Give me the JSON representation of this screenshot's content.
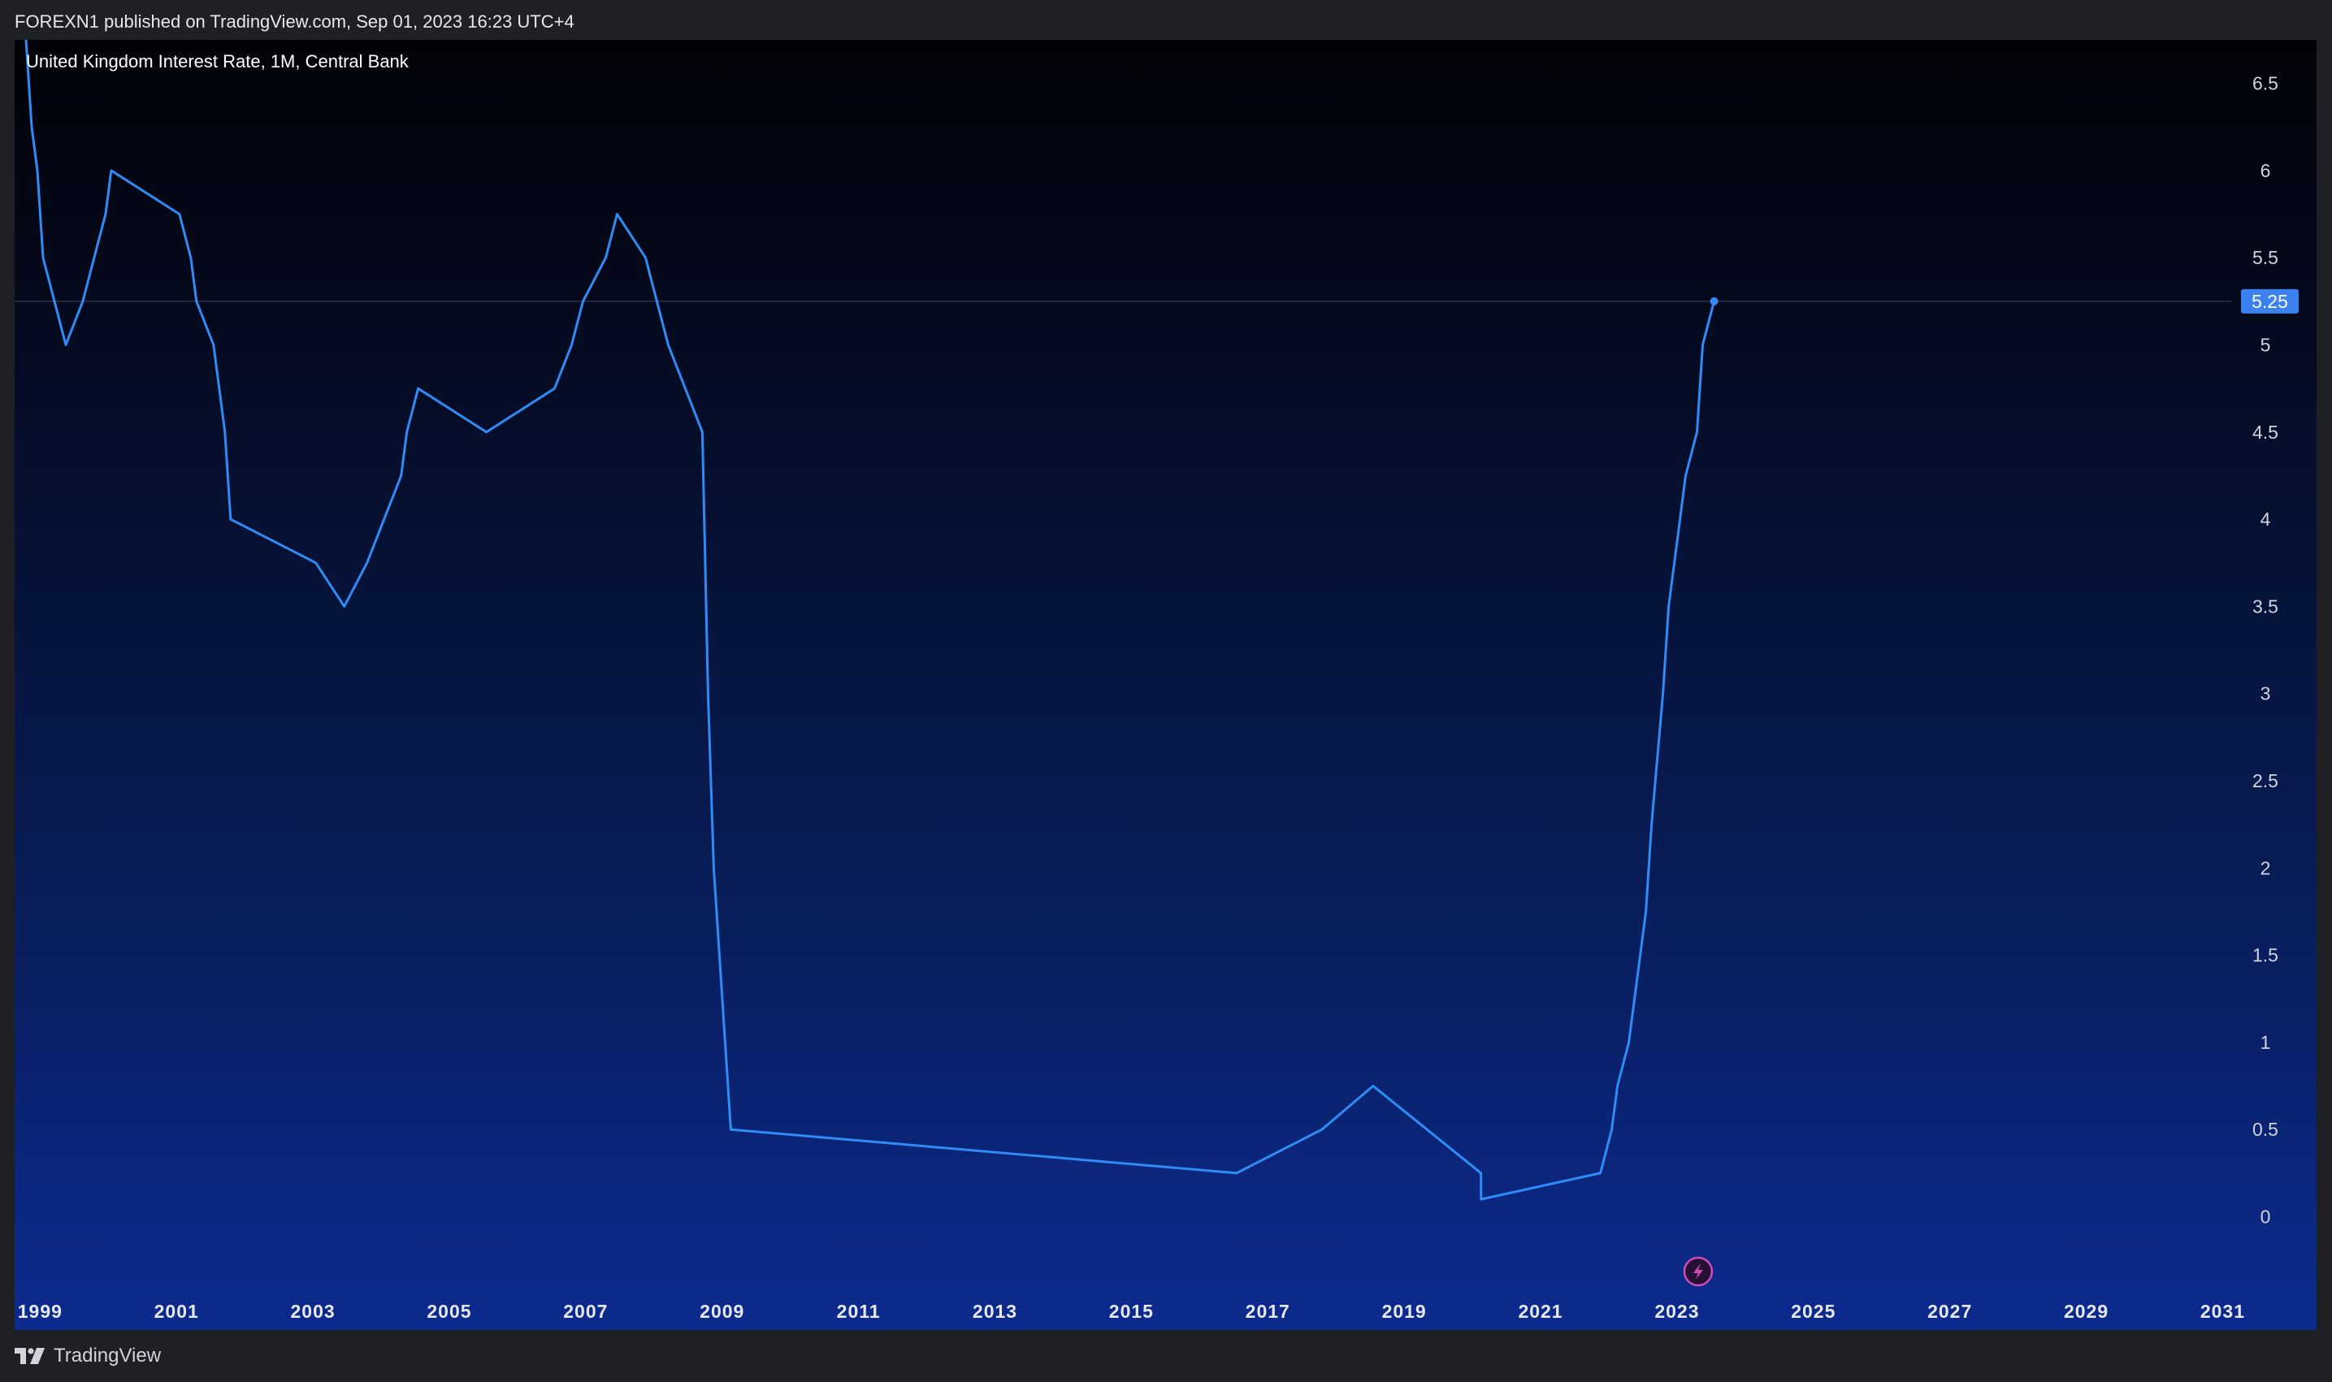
{
  "header": {
    "publish_line": "FOREXN1 published on TradingView.com, Sep 01, 2023 16:23 UTC+4"
  },
  "footer": {
    "brand": "TradingView"
  },
  "icons": {
    "footer_logo": "tradingview-logo-icon",
    "chart_event": "lightning-bolt-icon"
  },
  "colors": {
    "series_line": "#2f8bf5",
    "last_value_badge": "#3b82f0",
    "event_marker": "#d24ab8"
  },
  "chart_data": {
    "type": "line",
    "title": "United Kingdom Interest Rate, 1M, Central Bank",
    "xlabel": "",
    "ylabel": "",
    "x_axis_type": "date",
    "xlim": [
      "1998-09",
      "2032-06"
    ],
    "ylim": [
      -0.65,
      6.75
    ],
    "x_ticks": [
      "1999",
      "2001",
      "2003",
      "2005",
      "2007",
      "2009",
      "2011",
      "2013",
      "2015",
      "2017",
      "2019",
      "2021",
      "2023",
      "2025",
      "2027",
      "2029",
      "2031"
    ],
    "y_ticks": [
      0,
      0.5,
      1,
      1.5,
      2,
      2.5,
      3,
      3.5,
      4,
      4.5,
      5,
      5.5,
      6,
      6.5
    ],
    "grid": false,
    "last_value": 5.25,
    "series": [
      {
        "x": [
          "1998-10",
          "1998-11",
          "1998-12",
          "1999-01",
          "1999-02",
          "1999-04",
          "1999-06",
          "1999-09",
          "1999-11",
          "2000-01",
          "2000-02",
          "2001-02",
          "2001-04",
          "2001-05",
          "2001-08",
          "2001-09",
          "2001-10",
          "2001-11",
          "2003-02",
          "2003-07",
          "2003-11",
          "2004-02",
          "2004-05",
          "2004-06",
          "2004-08",
          "2005-08",
          "2006-08",
          "2006-11",
          "2007-01",
          "2007-05",
          "2007-07",
          "2007-12",
          "2008-02",
          "2008-04",
          "2008-10",
          "2008-11",
          "2008-12",
          "2009-01",
          "2009-02",
          "2009-03",
          "2016-08",
          "2017-11",
          "2018-08",
          "2020-03",
          "2020-03",
          "2021-12",
          "2022-02",
          "2022-03",
          "2022-05",
          "2022-06",
          "2022-08",
          "2022-09",
          "2022-11",
          "2022-12",
          "2023-02",
          "2023-03",
          "2023-05",
          "2023-06",
          "2023-08"
        ],
        "y": [
          7.25,
          6.75,
          6.25,
          6.0,
          5.5,
          5.25,
          5.0,
          5.25,
          5.5,
          5.75,
          6.0,
          5.75,
          5.5,
          5.25,
          5.0,
          4.75,
          4.5,
          4.0,
          3.75,
          3.5,
          3.75,
          4.0,
          4.25,
          4.5,
          4.75,
          4.5,
          4.75,
          5.0,
          5.25,
          5.5,
          5.75,
          5.5,
          5.25,
          5.0,
          4.5,
          3.0,
          2.0,
          1.5,
          1.0,
          0.5,
          0.25,
          0.5,
          0.75,
          0.25,
          0.1,
          0.25,
          0.5,
          0.75,
          1.0,
          1.25,
          1.75,
          2.25,
          3.0,
          3.5,
          4.0,
          4.25,
          4.5,
          5.0,
          5.25
        ]
      }
    ]
  }
}
